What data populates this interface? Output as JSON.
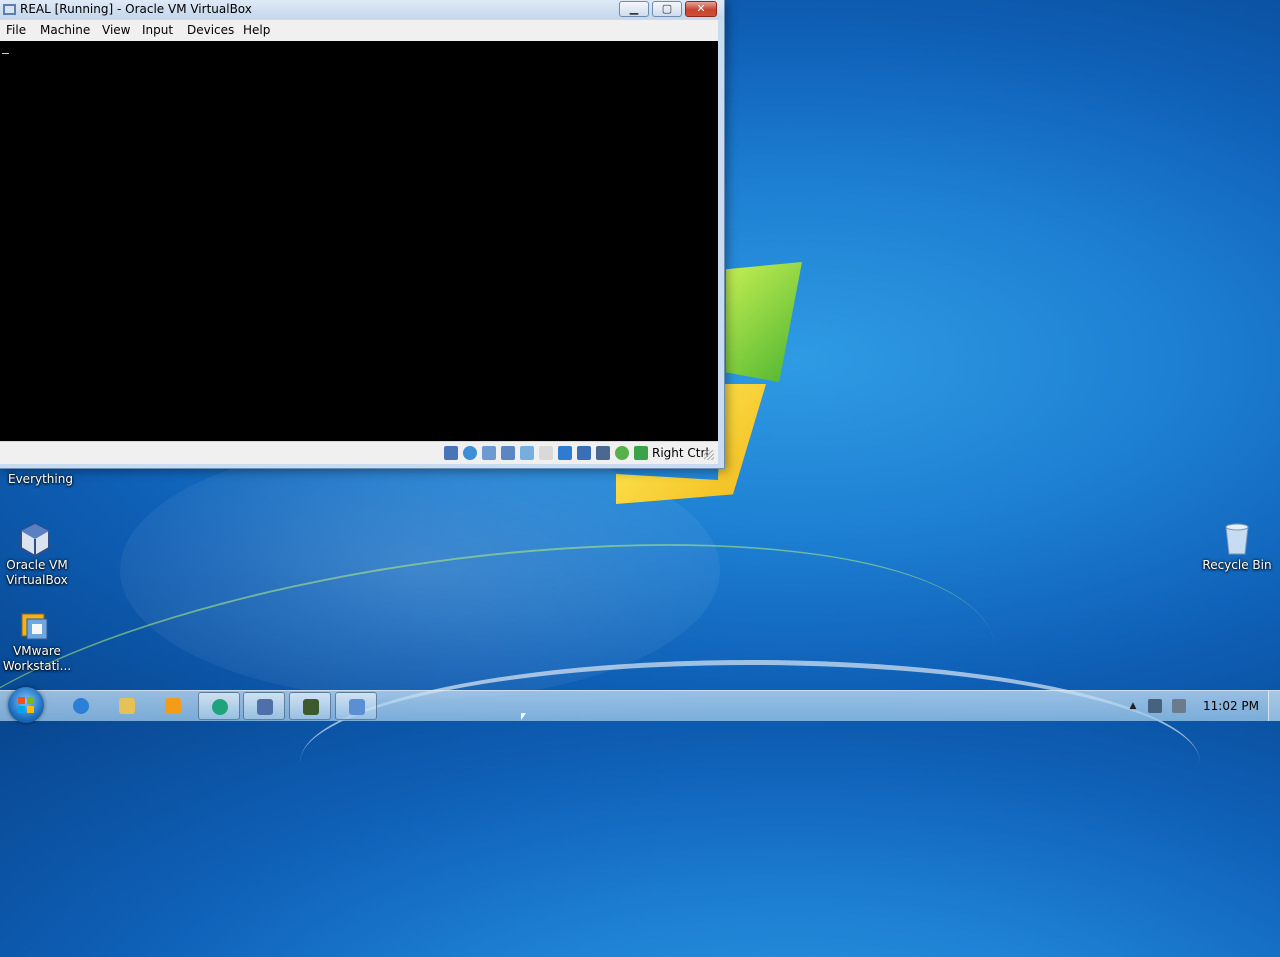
{
  "vbox_window": {
    "title": "REAL [Running] - Oracle VM VirtualBox",
    "menu": [
      "File",
      "Machine",
      "View",
      "Input",
      "Devices",
      "Help"
    ],
    "host_key": "Right Ctrl"
  },
  "desktop": {
    "everything_label": "Everything",
    "icons": [
      {
        "label": "Oracle VM VirtualBox",
        "icon": "virtualbox-icon"
      },
      {
        "label": "VMware Workstati...",
        "icon": "vmware-icon"
      },
      {
        "label": "Recycle Bin",
        "icon": "recycle-bin-icon"
      }
    ]
  },
  "taskbar": {
    "pinned": [
      "internet-explorer-icon",
      "windows-explorer-icon",
      "media-player-icon",
      "app-green-icon",
      "virtualbox-taskbar-icon",
      "vm-running-icon",
      "vm-window-icon"
    ],
    "clock": "11:02 PM"
  },
  "colors": {
    "desktop_blue": "#1d7fd2",
    "close_red": "#c5452f",
    "vm_screen": "#000000"
  }
}
